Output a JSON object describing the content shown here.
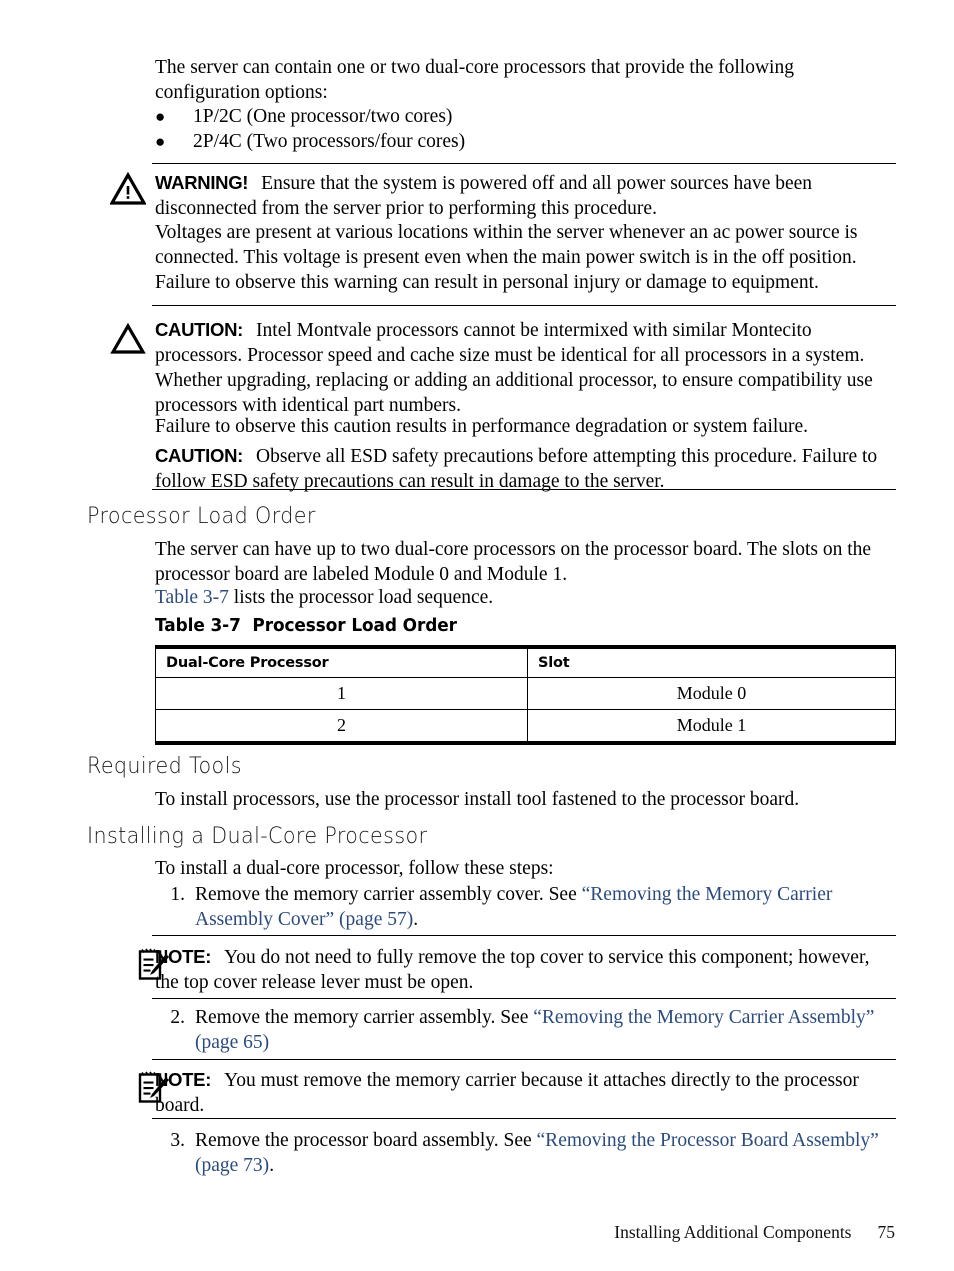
{
  "page": {
    "intro": "The server can contain one or two dual-core processors that provide the following configuration options:",
    "bullets": [
      "1P/2C (One processor/two cores)",
      "2P/4C (Two processors/four cores)"
    ]
  },
  "warning": {
    "icon": "warning-triangle-icon",
    "label": "WARNING!",
    "para1": "Ensure that the system is powered off and all power sources have been disconnected from the server prior to performing this procedure.",
    "para2": "Voltages are present at various locations within the server whenever an ac power source is connected. This voltage is present even when the main power switch is in the off position.",
    "para3": "Failure to observe this warning can result in personal injury or damage to equipment."
  },
  "caution1": {
    "icon": "caution-triangle-icon",
    "label": "CAUTION:",
    "para1": "Intel Montvale processors cannot be intermixed with similar Montecito processors. Processor speed and cache size must be identical for all processors in a system. Whether upgrading, replacing or adding an additional processor, to ensure compatibility use processors with identical part numbers.",
    "para2": "Failure to observe this caution results in performance degradation or system failure."
  },
  "caution2": {
    "label": "CAUTION:",
    "para1": "Observe all ESD safety precautions before attempting this procedure. Failure to follow ESD safety precautions can result in damage to the server."
  },
  "sections": {
    "processor_load_order": {
      "heading": "Processor Load Order",
      "para1": "The server can have up to two dual-core processors on the processor board. The slots on the processor board are labeled Module 0 and Module 1.",
      "xref_link": "Table 3-7",
      "xref_tail": " lists the processor load sequence."
    },
    "required_tools": {
      "heading": "Required Tools",
      "para1": "To install processors, use the processor install tool fastened to the processor board."
    },
    "installing": {
      "heading": "Installing a Dual-Core Processor",
      "intro": "To install a dual-core processor, follow these steps:"
    }
  },
  "table": {
    "caption_number": "Table  3-7",
    "caption_title": "Processor Load Order",
    "columns": [
      "Dual-Core Processor",
      "Slot"
    ],
    "rows": [
      [
        "1",
        "Module 0"
      ],
      [
        "2",
        "Module 1"
      ]
    ]
  },
  "steps": [
    {
      "num": "1.",
      "pre": "Remove the memory carrier assembly cover. See ",
      "link": "“Removing the Memory Carrier Assembly Cover” (page 57)",
      "post": "."
    },
    {
      "num": "2.",
      "pre": "Remove the memory carrier assembly. See ",
      "link": "“Removing the Memory Carrier Assembly” (page 65)",
      "post": ""
    },
    {
      "num": "3.",
      "pre": "Remove the processor board assembly. See ",
      "link": "“Removing the Processor Board Assembly” (page 73)",
      "post": "."
    }
  ],
  "notes": [
    {
      "icon": "note-pencil-icon",
      "label": "NOTE:",
      "text": "You do not need to fully remove the top cover to service this component; however, the top cover release lever must be open."
    },
    {
      "icon": "note-pencil-icon",
      "label": "NOTE:",
      "text": "You must remove the memory carrier because it attaches directly to the processor board."
    }
  ],
  "footer": {
    "chapter": "Installing Additional Components",
    "page_number": "75"
  },
  "colors": {
    "link": "#2b4b7e",
    "text": "#000000",
    "rule": "#000000"
  }
}
